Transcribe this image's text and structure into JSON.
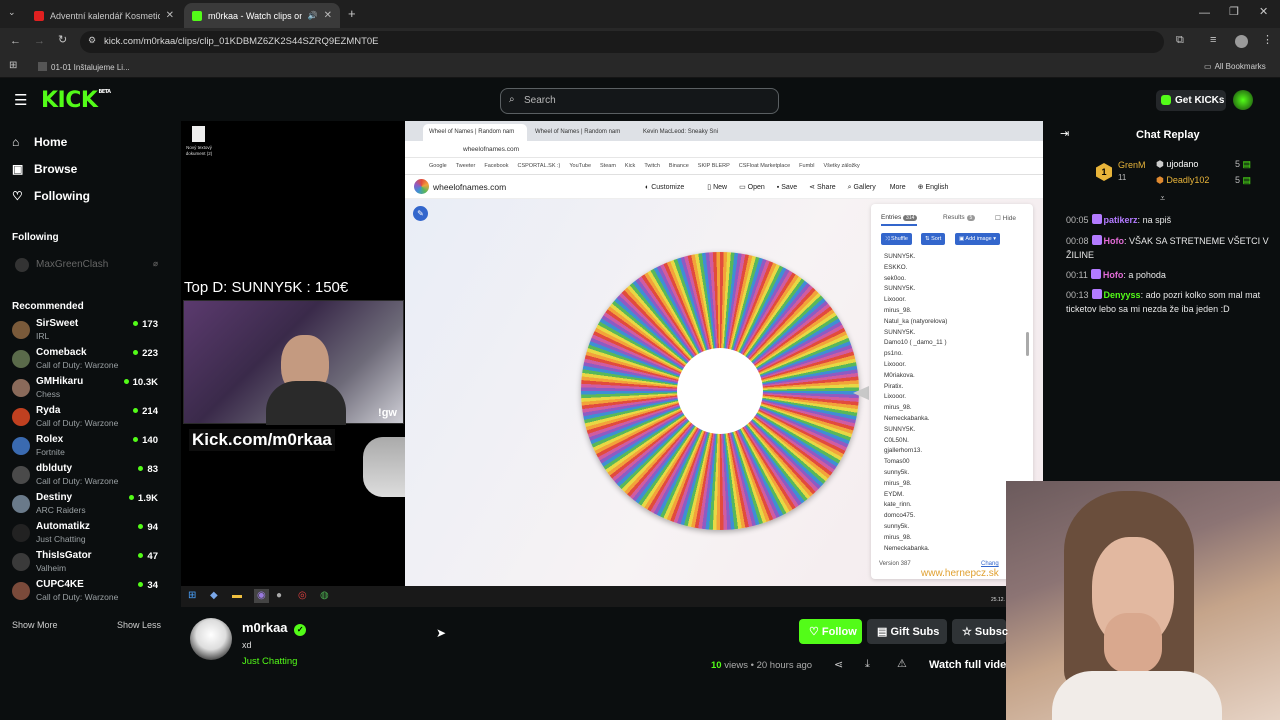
{
  "browser": {
    "tabs": [
      {
        "title": "Adventní kalendář Kosmetický/M",
        "active": false
      },
      {
        "title": "m0rkaa - Watch clips on Ki",
        "active": true
      }
    ],
    "url": "kick.com/m0rkaa/clips/clip_01KDBMZ6ZK2S44SZRQ9EZMNT0E",
    "bookmarks": [
      {
        "label": "01-01 Inštalujeme Li..."
      }
    ],
    "all_bookmarks": "All Bookmarks"
  },
  "header": {
    "logo": "KICK",
    "logo_badge": "BETA",
    "search_placeholder": "Search",
    "get_kicks": "Get KICKs"
  },
  "sidebar": {
    "nav": [
      {
        "label": "Home",
        "icon": "home-icon"
      },
      {
        "label": "Browse",
        "icon": "browse-icon"
      },
      {
        "label": "Following",
        "icon": "heart-icon"
      }
    ],
    "following_title": "Following",
    "following": [
      {
        "name": "MaxGreenClash"
      }
    ],
    "recommended_title": "Recommended",
    "recommended": [
      {
        "name": "SirSweet",
        "category": "IRL",
        "viewers": "173",
        "color": "#7a5a3a"
      },
      {
        "name": "Comeback",
        "category": "Call of Duty: Warzone",
        "viewers": "223",
        "color": "#5a6a4a"
      },
      {
        "name": "GMHikaru",
        "category": "Chess",
        "viewers": "10.3K",
        "color": "#8a6a5a"
      },
      {
        "name": "Ryda",
        "category": "Call of Duty: Warzone",
        "viewers": "214",
        "color": "#c04020"
      },
      {
        "name": "Rolex",
        "category": "Fortnite",
        "viewers": "140",
        "color": "#3a6ab0"
      },
      {
        "name": "dblduty",
        "category": "Call of Duty: Warzone",
        "viewers": "83",
        "color": "#4a4a4a"
      },
      {
        "name": "Destiny",
        "category": "ARC Raiders",
        "viewers": "1.9K",
        "color": "#6a7a8a"
      },
      {
        "name": "Automatikz",
        "category": "Just Chatting",
        "viewers": "94",
        "color": "#222222"
      },
      {
        "name": "ThisIsGator",
        "category": "Valheim",
        "viewers": "47",
        "color": "#3a3a3a"
      },
      {
        "name": "CUPC4KE",
        "category": "Call of Duty: Warzone",
        "viewers": "34",
        "color": "#7a4a3a"
      }
    ],
    "show_more": "Show More",
    "show_less": "Show Less"
  },
  "video": {
    "desktop_file": "Nový textový dokument (2)",
    "top_donor": "Top D: SUNNY5K : 150€",
    "overlay_tag": "!gw",
    "kick_overlay": "Kick.com/m0rkaa",
    "wheel": {
      "tabs": [
        "Wheel of Names | Random nam",
        "Wheel of Names | Random nam",
        "Kevin MacLeod: Sneaky Sni"
      ],
      "url": "wheelofnames.com",
      "bookmarks": [
        "Google",
        "Tweeter",
        "Facebook",
        "CSPORTAL.SK :)",
        "YouTube",
        "Steam",
        "Kick",
        "Twitch",
        "Binance",
        "SKIP BLERP",
        "CSFloat Marketplace",
        "Fumbl",
        "Všetky záložky"
      ],
      "site": "wheelofnames.com",
      "menu": [
        "Customize",
        "New",
        "Open",
        "Save",
        "Share",
        "Gallery",
        "More",
        "English"
      ],
      "entries_tab": "Entries",
      "entries_count": "314",
      "results_tab": "Results",
      "results_count": "5",
      "hide": "Hide",
      "shuffle": "Shuffle",
      "sort": "Sort",
      "add_image": "Add image",
      "entries": [
        "SUNNY5K.",
        "ESKKO.",
        "sek0oo.",
        "SUNNY5K.",
        "Lixooor.",
        "mirus_98.",
        "Natul_ka (natyorelova)",
        "SUNNY5K.",
        "Damo10 ( _damo_11 )",
        "ps1no.",
        "Lixooor.",
        "M0riakova.",
        "Piratix.",
        "Lixooor.",
        "mirus_98.",
        "Nemeckabanka.",
        "SUNNY5K.",
        "C0L50N.",
        "gjallerhorn13.",
        "Tomas00",
        "sunny5k.",
        "mirus_98.",
        "EYDM.",
        "kate_rinn.",
        "domco475.",
        "sunny5k.",
        "mirus_98.",
        "Nemeckabanka."
      ],
      "version": "Version 387",
      "changelog": "Chang",
      "watermark": "www.hernepcz.sk"
    },
    "clock": "25.12."
  },
  "stream": {
    "channel": "m0rkaa",
    "title": "xd",
    "category": "Just Chatting",
    "follow": "Follow",
    "gift_subs": "Gift Subs",
    "subscribe": "Subsc",
    "views_count": "10",
    "views_label": "views",
    "age": "20 hours ago",
    "watch_full": "Watch full vide"
  },
  "chat": {
    "title": "Chat Replay",
    "gifter": {
      "rank": "1",
      "name": "GrenM",
      "count": "11",
      "u1": "ujodano",
      "u1count": "5",
      "u2": "Deadly102",
      "u2count": "5"
    },
    "messages": [
      {
        "time": "00:05",
        "user": "patikerz",
        "color": "#b37bff",
        "text": "na spiš"
      },
      {
        "time": "00:08",
        "user": "Hofo",
        "color": "#e26bd6",
        "text": "VŠAK SA STRETNEME VŠETCI V ŽILINE"
      },
      {
        "time": "00:11",
        "user": "Hofo",
        "color": "#e26bd6",
        "text": "a pohoda"
      },
      {
        "time": "00:13",
        "user": "Denyyss",
        "color": "#53fc18",
        "text": "ado pozri kolko som mal mat ticketov lebo sa mi nezda že iba jeden :D"
      }
    ]
  },
  "colors": {
    "kick_green": "#53fc18",
    "background": "#0b0e0f"
  }
}
